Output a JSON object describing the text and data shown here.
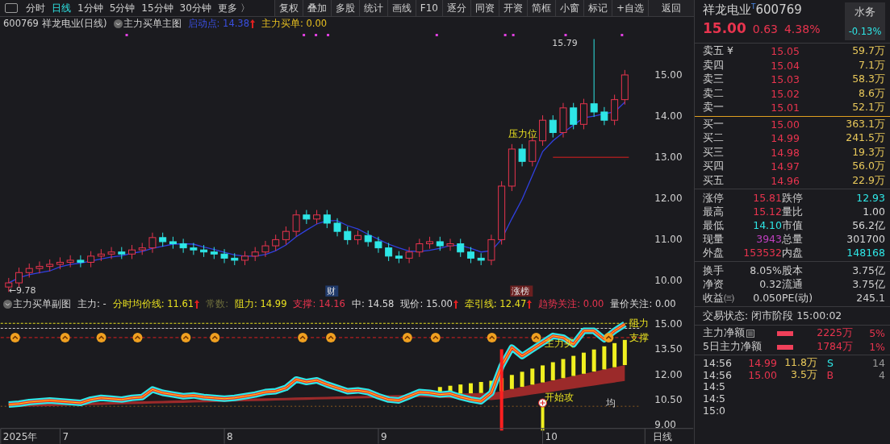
{
  "toolbar": {
    "periods": [
      {
        "label": "分时",
        "selected": false
      },
      {
        "label": "日线",
        "selected": true
      },
      {
        "label": "1分钟",
        "selected": false
      },
      {
        "label": "5分钟",
        "selected": false
      },
      {
        "label": "15分钟",
        "selected": false
      },
      {
        "label": "30分钟",
        "selected": false
      },
      {
        "label": "更多 〉",
        "selected": false
      }
    ],
    "buttons": [
      "复权",
      "叠加",
      "多股",
      "统计",
      "画线",
      "F10",
      "逐分",
      "同资",
      "开资",
      "简框",
      "小窗",
      "标记",
      "+自选",
      "返回"
    ]
  },
  "main_header": {
    "title": "600769 祥龙电业(日线)",
    "indicator": "主力买单主图",
    "items": [
      {
        "text": "启动点: 14.38",
        "color": "#3a4fe0",
        "arrow": true
      },
      {
        "text": "主力买单: 0.00",
        "color": "#e8c020",
        "arrow": false
      }
    ]
  },
  "main_chart": {
    "y_labels": [
      "15.00",
      "14.00",
      "13.00",
      "12.00",
      "11.00",
      "10.00"
    ],
    "notes": [
      "15.79",
      "压力位",
      "←9.78"
    ],
    "tags": [
      "财",
      "涨榜"
    ]
  },
  "sub_header": {
    "indicator": "主力买单副图",
    "items": [
      {
        "text": "主力: -",
        "color": "#d8d8d8",
        "arrow": false
      },
      {
        "text": "分时均价线: 11.61",
        "color": "#e8e020",
        "arrow": true
      },
      {
        "text": "常数:",
        "color": "#6c6c3c",
        "arrow": false
      },
      {
        "text": "阻力: 14.99",
        "color": "#e8e020",
        "arrow": false
      },
      {
        "text": "支撑: 14.16",
        "color": "#e8344e",
        "arrow": false
      },
      {
        "text": "中: 14.58",
        "color": "#d8d8d8",
        "arrow": false
      },
      {
        "text": "现价: 15.00",
        "color": "#d8d8d8",
        "arrow": true
      },
      {
        "text": "牵引线: 12.47",
        "color": "#e8e020",
        "arrow": true
      },
      {
        "text": "趋势关注: 0.00",
        "color": "#e8344e",
        "arrow": false
      },
      {
        "text": "量价关注: 0.00",
        "color": "#d8d8d8",
        "arrow": false
      }
    ]
  },
  "sub_chart": {
    "y_labels": [
      "15.00",
      "13.50",
      "12.00",
      "10.50",
      "9.00"
    ],
    "notes": [
      "主力买",
      "开始攻",
      "均",
      "阻力",
      "支撑"
    ],
    "x_labels": [
      "2025年",
      "7",
      "8",
      "9",
      "10"
    ],
    "period_label": "日线"
  },
  "quote": {
    "name": "祥龙电业",
    "mark": "T",
    "code": "600769",
    "price": "15.00",
    "change": "0.63",
    "percent": "4.38%",
    "sector": {
      "name": "水务",
      "change": "-0.13%"
    },
    "asks": [
      {
        "label": "卖五 ¥",
        "price": "15.05",
        "volume": "59.7万"
      },
      {
        "label": "卖四",
        "price": "15.04",
        "volume": "7.1万"
      },
      {
        "label": "卖三",
        "price": "15.03",
        "volume": "58.3万"
      },
      {
        "label": "卖二",
        "price": "15.02",
        "volume": "8.6万"
      },
      {
        "label": "卖一",
        "price": "15.01",
        "volume": "52.1万"
      }
    ],
    "bids": [
      {
        "label": "买一",
        "price": "15.00",
        "volume": "363.1万"
      },
      {
        "label": "买二",
        "price": "14.99",
        "volume": "241.5万"
      },
      {
        "label": "买三",
        "price": "14.98",
        "volume": "19.3万"
      },
      {
        "label": "买四",
        "price": "14.97",
        "volume": "56.0万"
      },
      {
        "label": "买五",
        "price": "14.96",
        "volume": "22.9万"
      }
    ],
    "stats": [
      {
        "label": "涨停",
        "value": "15.81",
        "color": "#e8344e"
      },
      {
        "label": "跌停",
        "value": "12.93",
        "color": "#2ee6e6"
      },
      {
        "label": "最高",
        "value": "15.12",
        "color": "#e8344e"
      },
      {
        "label": "量比",
        "value": "1.00",
        "color": "#d8d8d8"
      },
      {
        "label": "最低",
        "value": "14.10",
        "color": "#2ee6e6"
      },
      {
        "label": "市值",
        "value": "56.2亿",
        "color": "#d8d8d8"
      },
      {
        "label": "现量",
        "value": "3943",
        "color": "#c040c0"
      },
      {
        "label": "总量",
        "value": "301700",
        "color": "#d8d8d8"
      },
      {
        "label": "外盘",
        "value": "153532",
        "color": "#e8344e"
      },
      {
        "label": "内盘",
        "value": "148168",
        "color": "#2ee6e6"
      }
    ],
    "finance": [
      {
        "label": "换手",
        "value": "8.05%"
      },
      {
        "label": "股本",
        "value": "3.75亿"
      },
      {
        "label": "净资",
        "value": "0.32"
      },
      {
        "label": "流通",
        "value": "3.75亿"
      },
      {
        "label": "收益㈢",
        "value": "0.050"
      },
      {
        "label": "PE(动)",
        "value": "245.1"
      }
    ],
    "status": "交易状态: 闭市阶段 15:00:02",
    "flows": [
      {
        "label": "主力净额",
        "menu": true,
        "amount": "2225万",
        "percent": "5%"
      },
      {
        "label": "5日主力净额",
        "menu": false,
        "amount": "1784万",
        "percent": "1%"
      }
    ],
    "ticks": [
      {
        "time": "14:56",
        "price": "14.99",
        "volume": "11.8万",
        "side": "S",
        "color": "#2ee6e6",
        "count": "14"
      },
      {
        "time": "14:56",
        "price": "15.00",
        "volume": "3.5万",
        "side": "B",
        "color": "#e8344e",
        "count": "4"
      },
      {
        "time": "14:5"
      },
      {
        "time": "14:5"
      },
      {
        "time": "15:0"
      }
    ]
  }
}
